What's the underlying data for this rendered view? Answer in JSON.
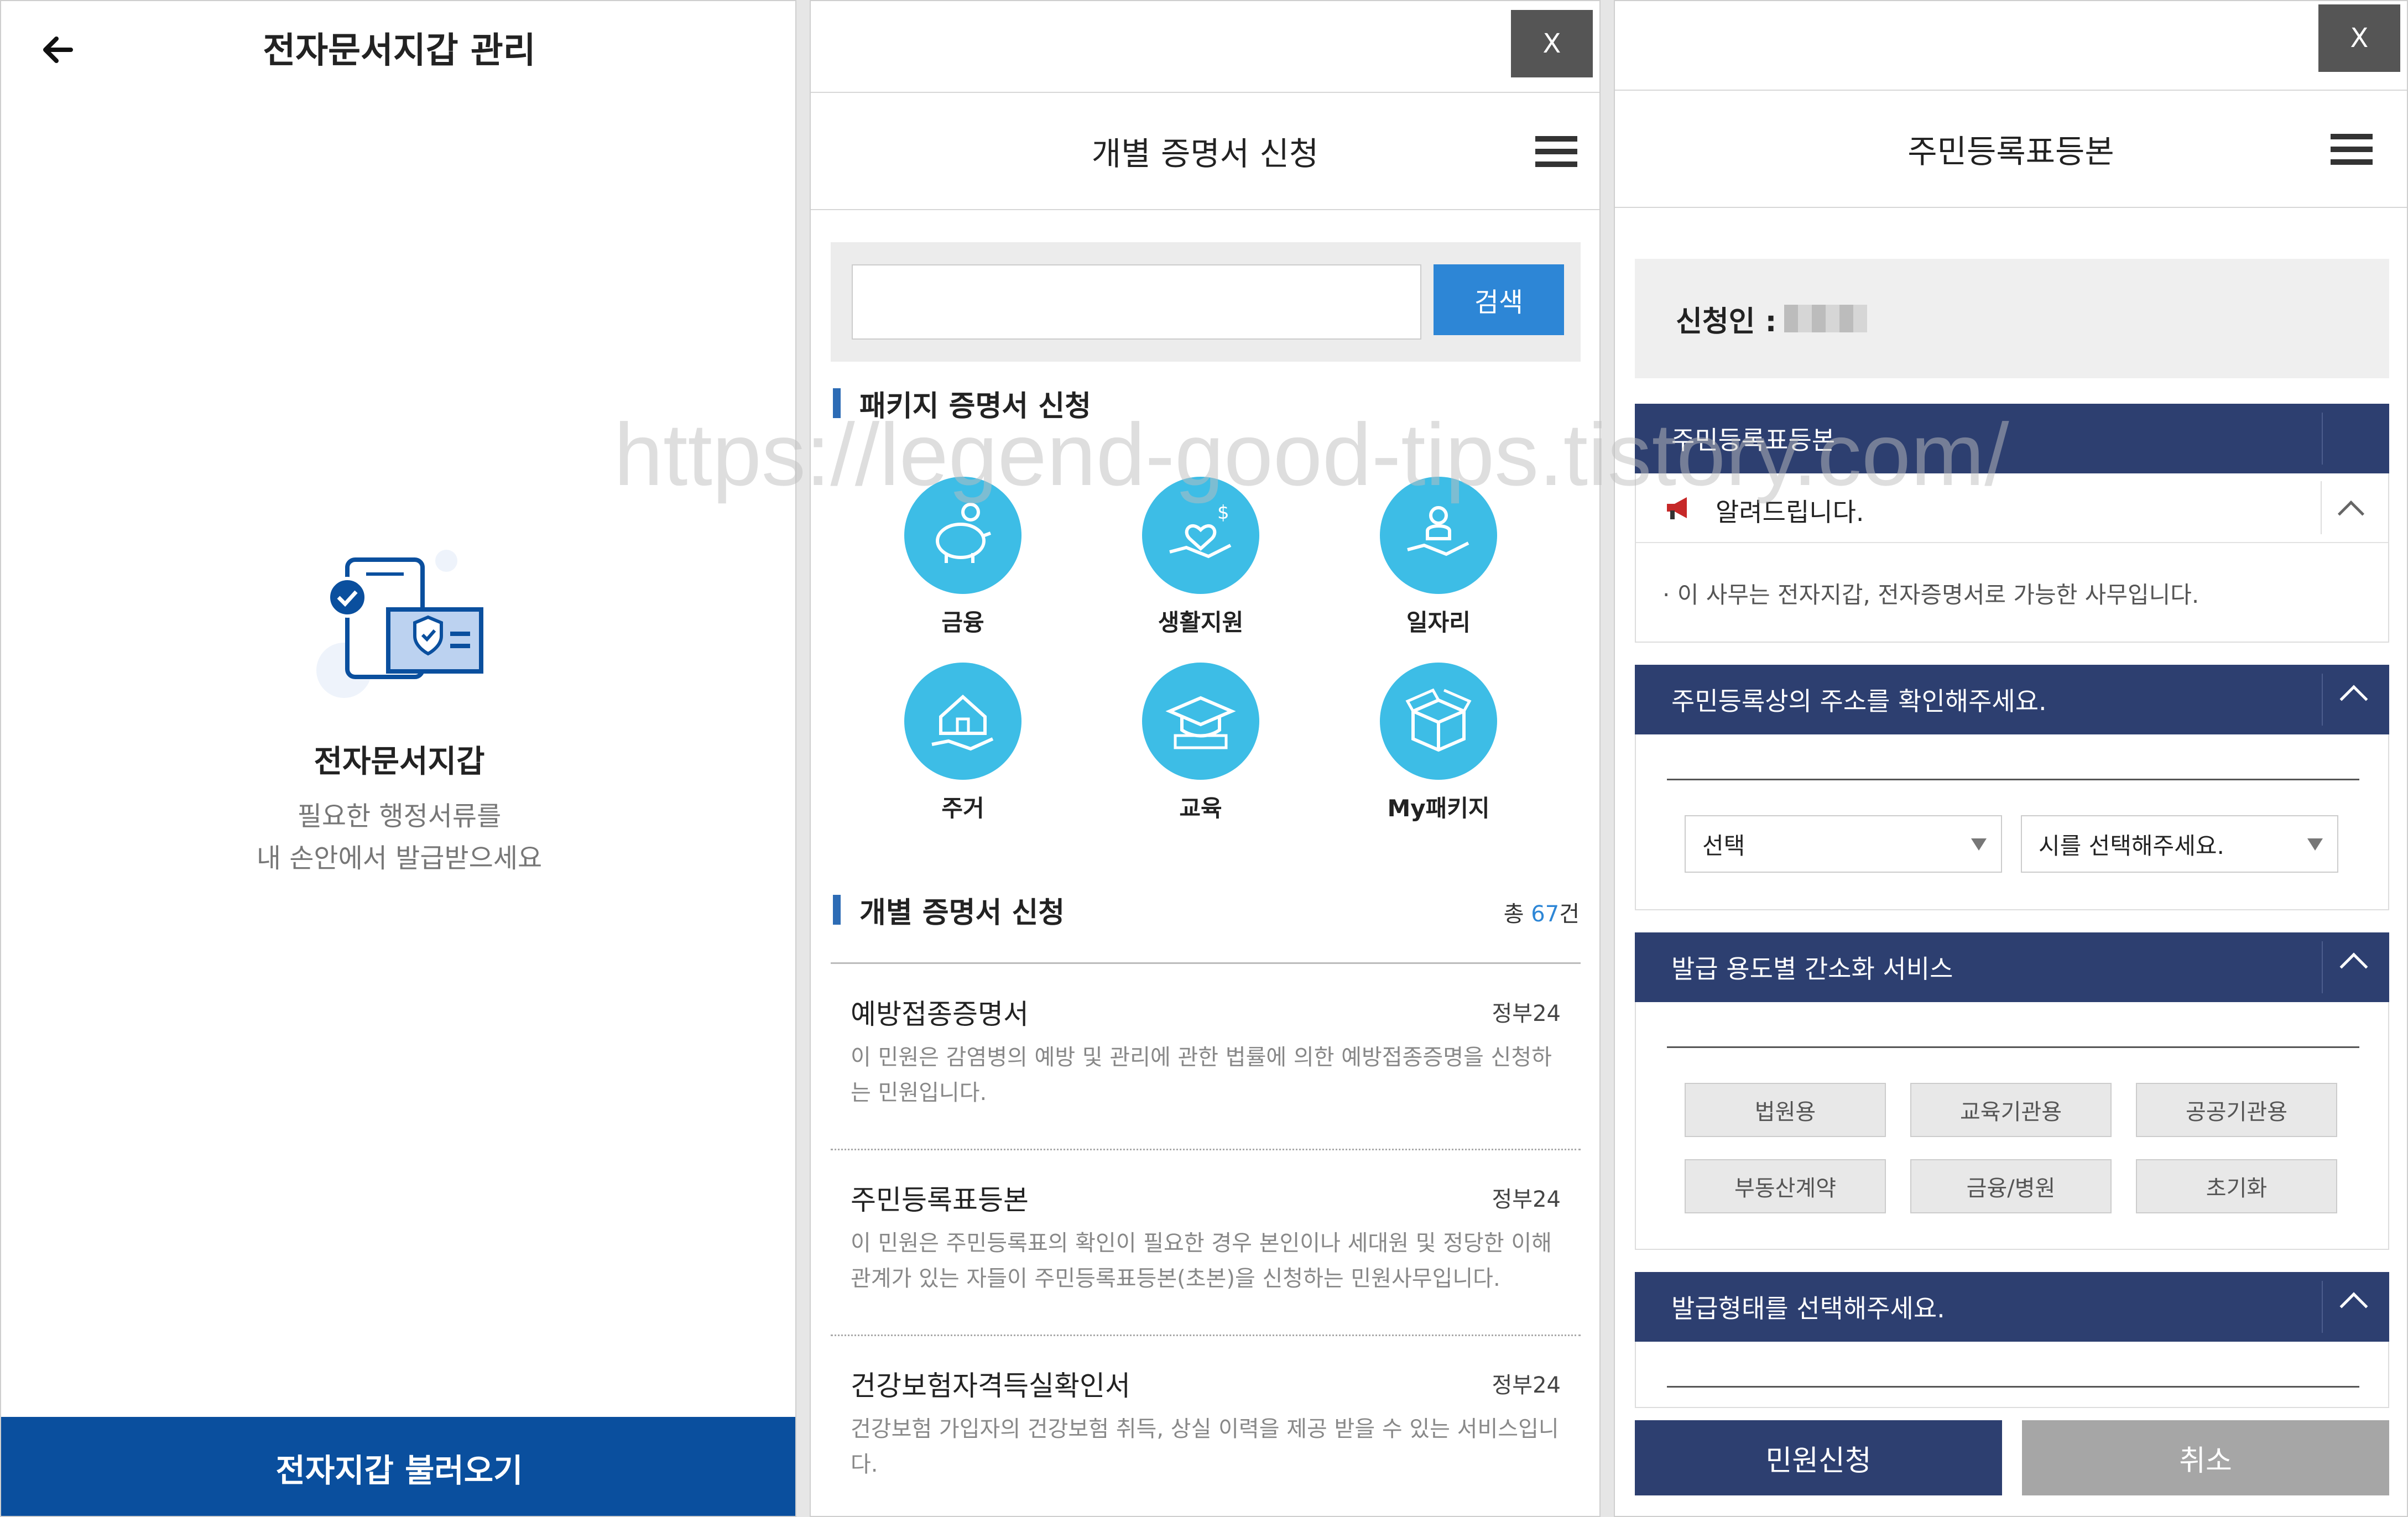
{
  "panel1": {
    "title": "전자문서지갑 관리",
    "heading": "전자문서지갑",
    "desc_line1": "필요한 행정서류를",
    "desc_line2": "내 손안에서 발급받으세요",
    "button": "전자지갑 불러오기"
  },
  "panel2": {
    "close": "X",
    "title": "개별 증명서 신청",
    "search_button": "검색",
    "package_section": "패키지 증명서 신청",
    "categories": [
      {
        "label": "금융",
        "icon": "piggy-bank-icon"
      },
      {
        "label": "생활지원",
        "icon": "hand-heart-icon"
      },
      {
        "label": "일자리",
        "icon": "hand-worker-icon"
      },
      {
        "label": "주거",
        "icon": "house-hand-icon"
      },
      {
        "label": "교육",
        "icon": "graduation-cap-icon"
      },
      {
        "label": "My패키지",
        "icon": "open-box-icon"
      }
    ],
    "individual_section": "개별 증명서 신청",
    "total_prefix": "총 ",
    "total_count": "67",
    "total_suffix": "건",
    "items": [
      {
        "title": "예방접종증명서",
        "org": "정부24",
        "desc": "이 민원은 감염병의 예방 및 관리에 관한 법률에 의한 예방접종증명을 신청하는 민원입니다."
      },
      {
        "title": "주민등록표등본",
        "org": "정부24",
        "desc": "이 민원은 주민등록표의 확인이 필요한 경우 본인이나 세대원 및 정당한 이해관계가 있는 자들이 주민등록표등본(초본)을 신청하는 민원사무입니다."
      },
      {
        "title": "건강보험자격득실확인서",
        "org": "정부24",
        "desc": "건강보험 가입자의 건강보험 취득, 상실 이력을 제공 받을 수 있는 서비스입니다."
      }
    ]
  },
  "panel3": {
    "close": "X",
    "title": "주민등록표등본",
    "applicant_label": "신청인 :",
    "section1": "주민등록표등본",
    "notice_title": "알려드립니다.",
    "notice_text": "· 이 사무는 전자지갑, 전자증명서로 가능한 사무입니다.",
    "section2": "주민등록상의 주소를 확인해주세요.",
    "select1": "선택",
    "select2": "시를 선택해주세요.",
    "section3": "발급 용도별 간소화 서비스",
    "purposes": [
      "법원용",
      "교육기관용",
      "공공기관용",
      "부동산계약",
      "금융/병원",
      "초기화"
    ],
    "section4": "발급형태를 선택해주세요.",
    "submit": "민원신청",
    "cancel": "취소"
  },
  "watermark": "https://legend-good-tips.tistory.com/",
  "colors": {
    "navy": "#2d3f70",
    "blue": "#0a4f9e",
    "sky": "#3dbde6",
    "search": "#2d86d6"
  }
}
